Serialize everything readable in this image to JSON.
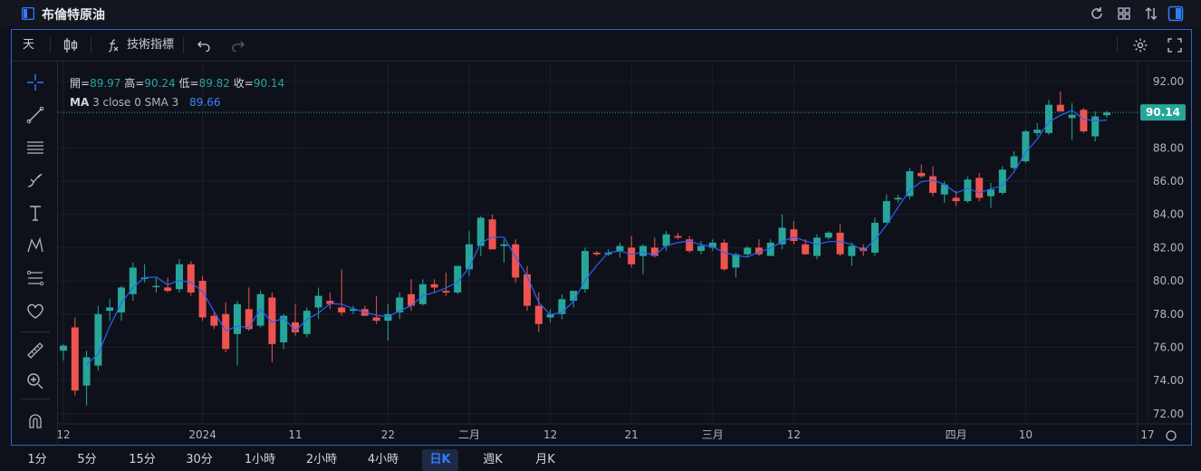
{
  "window": {
    "title": "布倫特原油"
  },
  "toolbar": {
    "interval": "天",
    "indicators_label": "技術指標"
  },
  "legend": {
    "open_label": "開=",
    "open": "89.97",
    "high_label": "高=",
    "high": "90.24",
    "low_label": "低=",
    "low": "89.82",
    "close_label": "收=",
    "close": "90.14",
    "ma_title": "MA",
    "ma_params": "3 close 0 SMA 3",
    "ma_value": "89.66"
  },
  "price_axis": {
    "ticks": [
      "92.00",
      "88.00",
      "86.00",
      "84.00",
      "82.00",
      "80.00",
      "78.00",
      "76.00",
      "74.00",
      "72.00"
    ],
    "last_price": "90.14"
  },
  "time_axis": {
    "ticks": [
      "12",
      "2024",
      "11",
      "22",
      "二月",
      "12",
      "21",
      "三月",
      "12",
      "四月",
      "10",
      "17"
    ]
  },
  "timeframes": [
    "1分",
    "5分",
    "15分",
    "30分",
    "1小時",
    "2小時",
    "4小時",
    "日K",
    "週K",
    "月K"
  ],
  "active_timeframe": "日K",
  "colors": {
    "up": "#26a69a",
    "down": "#ef5350",
    "ma": "#2962ff",
    "accent": "#2f63c4",
    "background": "#0f111a"
  },
  "chart_data": {
    "type": "candlestick",
    "y_range": [
      71.5,
      93.2
    ],
    "ohlc": [
      [
        75.8,
        76.2,
        75.2,
        76.1
      ],
      [
        77.2,
        77.8,
        73.1,
        73.4
      ],
      [
        73.7,
        75.8,
        72.5,
        75.4
      ],
      [
        74.9,
        78.5,
        74.6,
        78.0
      ],
      [
        78.2,
        78.9,
        77.6,
        78.4
      ],
      [
        78.1,
        79.7,
        77.6,
        79.6
      ],
      [
        79.2,
        81.1,
        78.8,
        80.8
      ],
      [
        80.2,
        81.0,
        79.9,
        80.2
      ],
      [
        79.7,
        80.2,
        79.3,
        79.7
      ],
      [
        79.6,
        80.2,
        79.3,
        79.4
      ],
      [
        79.5,
        81.3,
        79.3,
        81.0
      ],
      [
        81.0,
        81.2,
        79.1,
        79.3
      ],
      [
        80.0,
        80.3,
        77.6,
        77.8
      ],
      [
        77.9,
        78.1,
        77.1,
        77.3
      ],
      [
        78.0,
        78.7,
        75.7,
        75.9
      ],
      [
        76.8,
        78.8,
        74.9,
        78.6
      ],
      [
        78.3,
        79.6,
        77.0,
        77.1
      ],
      [
        77.3,
        79.4,
        77.2,
        79.2
      ],
      [
        79.0,
        79.3,
        75.1,
        76.2
      ],
      [
        76.3,
        78.0,
        75.9,
        77.9
      ],
      [
        77.5,
        78.6,
        76.7,
        76.9
      ],
      [
        76.8,
        78.4,
        76.6,
        78.2
      ],
      [
        78.4,
        79.6,
        77.7,
        79.1
      ],
      [
        78.8,
        79.3,
        78.3,
        78.6
      ],
      [
        78.4,
        80.7,
        77.9,
        78.1
      ],
      [
        78.2,
        78.5,
        78.0,
        78.3
      ],
      [
        78.3,
        78.5,
        77.9,
        77.9
      ],
      [
        77.8,
        79.1,
        77.4,
        77.6
      ],
      [
        77.6,
        78.6,
        76.4,
        78.0
      ],
      [
        78.1,
        79.3,
        77.7,
        79.0
      ],
      [
        79.2,
        80.1,
        78.2,
        78.5
      ],
      [
        78.6,
        80.1,
        78.5,
        79.8
      ],
      [
        79.8,
        80.1,
        79.3,
        79.6
      ],
      [
        79.4,
        80.5,
        79.1,
        79.3
      ],
      [
        79.3,
        80.9,
        79.2,
        80.9
      ],
      [
        80.7,
        83.0,
        80.3,
        82.2
      ],
      [
        82.1,
        83.9,
        81.5,
        83.8
      ],
      [
        83.7,
        84.0,
        81.9,
        81.9
      ],
      [
        82.1,
        82.5,
        81.1,
        82.2
      ],
      [
        82.2,
        82.5,
        79.9,
        80.2
      ],
      [
        80.4,
        80.9,
        78.2,
        78.5
      ],
      [
        78.5,
        79.3,
        76.9,
        77.4
      ],
      [
        77.8,
        78.3,
        77.5,
        78.0
      ],
      [
        78.0,
        79.2,
        77.7,
        78.9
      ],
      [
        78.8,
        79.4,
        78.4,
        79.4
      ],
      [
        79.5,
        82.0,
        79.3,
        81.8
      ],
      [
        81.7,
        81.8,
        81.5,
        81.6
      ],
      [
        81.6,
        81.9,
        81.5,
        81.7
      ],
      [
        81.8,
        82.3,
        81.4,
        82.1
      ],
      [
        82.0,
        82.7,
        80.8,
        81.0
      ],
      [
        81.5,
        82.2,
        80.4,
        82.1
      ],
      [
        82.0,
        82.6,
        81.4,
        81.5
      ],
      [
        82.1,
        83.0,
        81.8,
        82.8
      ],
      [
        82.7,
        82.9,
        82.5,
        82.6
      ],
      [
        82.5,
        82.7,
        81.7,
        81.8
      ],
      [
        81.8,
        82.4,
        81.6,
        82.1
      ],
      [
        82.0,
        82.5,
        81.8,
        82.3
      ],
      [
        82.3,
        82.5,
        80.6,
        80.7
      ],
      [
        80.8,
        81.7,
        80.2,
        81.6
      ],
      [
        81.6,
        82.1,
        81.4,
        82.0
      ],
      [
        82.0,
        82.5,
        81.5,
        81.6
      ],
      [
        81.5,
        82.5,
        81.5,
        82.3
      ],
      [
        82.2,
        84.0,
        81.9,
        83.2
      ],
      [
        83.1,
        83.6,
        82.2,
        82.4
      ],
      [
        82.2,
        82.5,
        81.6,
        81.6
      ],
      [
        81.5,
        82.8,
        81.3,
        82.6
      ],
      [
        82.6,
        83.0,
        82.5,
        82.9
      ],
      [
        82.9,
        83.4,
        81.5,
        81.6
      ],
      [
        81.5,
        82.3,
        80.9,
        82.1
      ],
      [
        82.0,
        82.2,
        81.5,
        81.8
      ],
      [
        81.7,
        83.8,
        81.5,
        83.5
      ],
      [
        83.5,
        85.2,
        83.5,
        84.8
      ],
      [
        84.9,
        85.2,
        84.7,
        85.0
      ],
      [
        85.1,
        86.8,
        84.9,
        86.6
      ],
      [
        86.5,
        87.0,
        86.2,
        86.3
      ],
      [
        86.3,
        86.9,
        85.1,
        85.3
      ],
      [
        85.2,
        86.0,
        84.7,
        85.8
      ],
      [
        85.0,
        85.4,
        84.5,
        84.8
      ],
      [
        84.8,
        86.3,
        84.7,
        86.1
      ],
      [
        86.2,
        86.5,
        84.8,
        85.0
      ],
      [
        85.1,
        85.9,
        84.4,
        85.5
      ],
      [
        85.3,
        86.9,
        85.2,
        86.7
      ],
      [
        86.8,
        87.8,
        86.7,
        87.5
      ],
      [
        87.2,
        89.1,
        87.1,
        89.0
      ],
      [
        88.9,
        89.5,
        88.7,
        89.1
      ],
      [
        88.9,
        90.9,
        88.8,
        90.6
      ],
      [
        90.6,
        91.4,
        90.2,
        90.2
      ],
      [
        89.8,
        90.7,
        88.5,
        90.0
      ],
      [
        90.3,
        90.4,
        88.9,
        89.0
      ],
      [
        88.7,
        90.2,
        88.4,
        89.9
      ],
      [
        89.97,
        90.24,
        89.82,
        90.14
      ]
    ],
    "ma_series": {
      "name": "MA 3 close 0 SMA 3"
    }
  }
}
